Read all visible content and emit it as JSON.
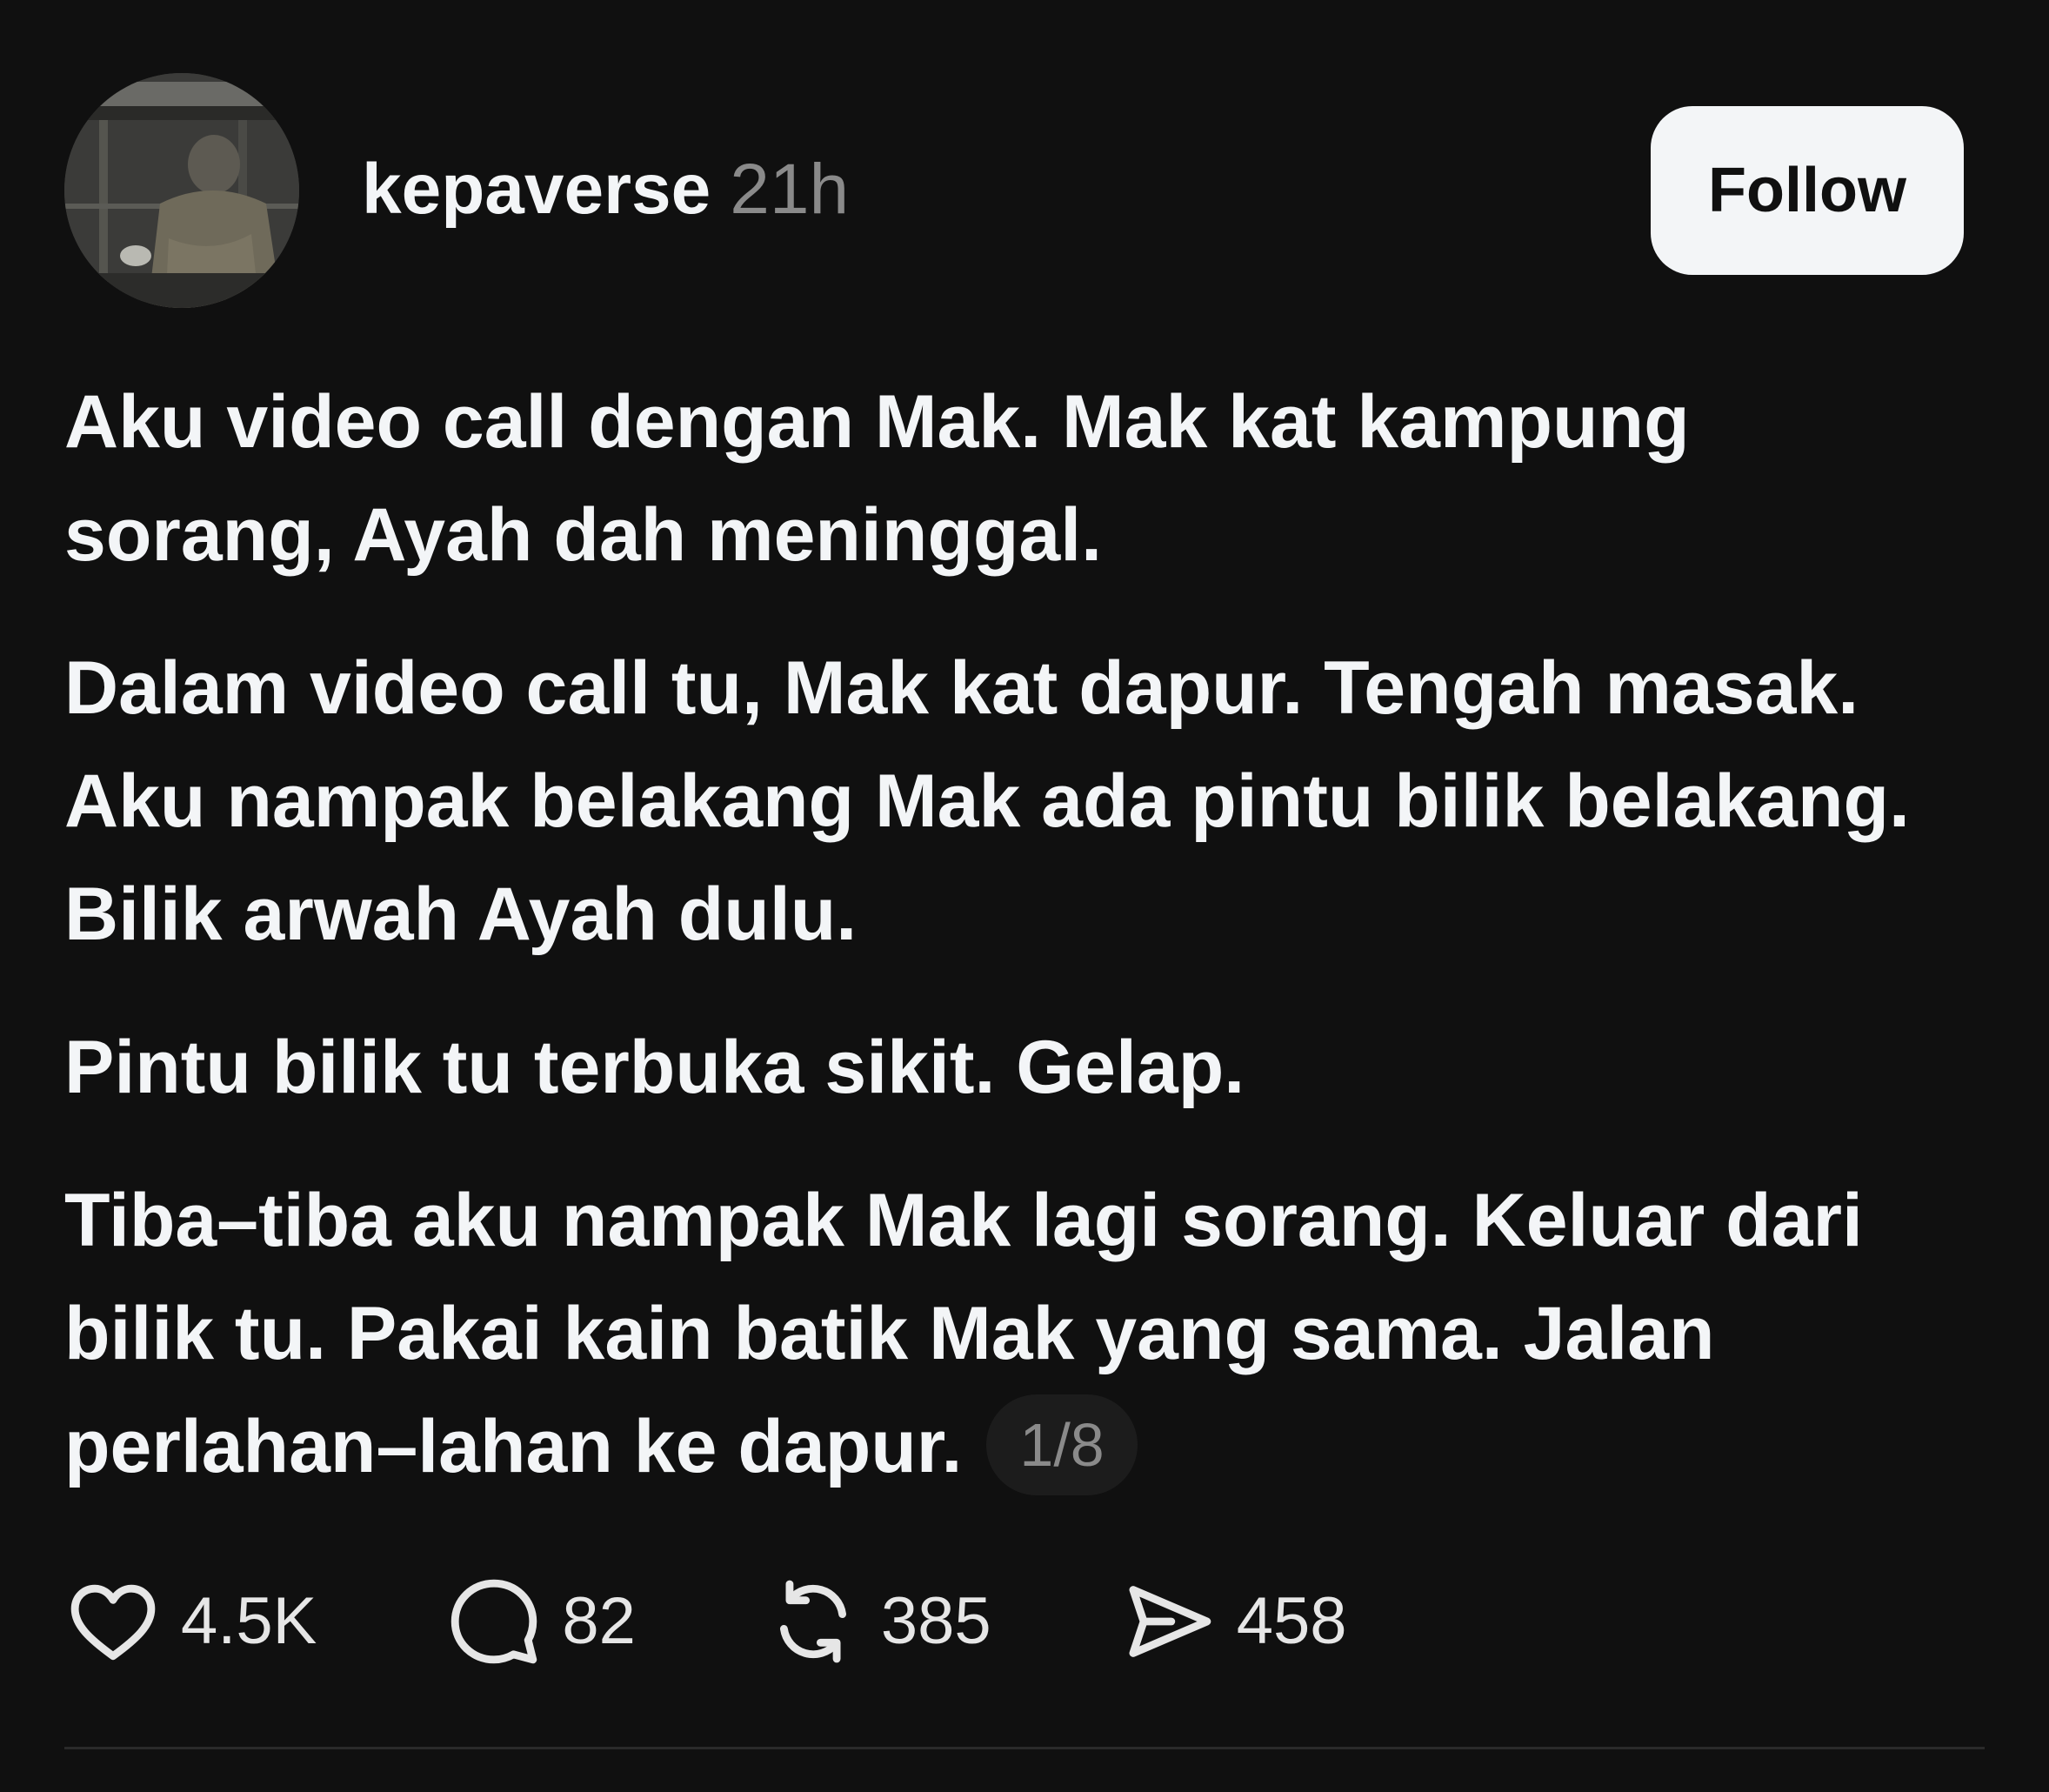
{
  "post": {
    "username": "kepaverse",
    "timestamp": "21h",
    "follow_label": "Follow",
    "paragraphs": [
      "Aku video call dengan Mak. Mak kat kampung sorang, Ayah dah meninggal.",
      "Dalam video call tu, Mak kat dapur. Tengah masak. Aku nampak belakang Mak ada pintu bilik belakang. Bilik arwah Ayah dulu.",
      "Pintu bilik tu terbuka sikit. Gelap.",
      "Tiba–tiba aku nampak Mak lagi sorang. Keluar dari bilik tu. Pakai kain batik Mak yang sama. Jalan perlahan–lahan ke dapur."
    ],
    "page_indicator": "1/8"
  },
  "actions": {
    "likes": "4.5K",
    "replies": "82",
    "reposts": "385",
    "shares": "458"
  },
  "icons": {
    "like": "heart-icon",
    "reply": "comment-bubble-icon",
    "repost": "repost-icon",
    "share": "send-icon"
  },
  "colors": {
    "background": "#101010",
    "text_primary": "#f3f5f7",
    "text_secondary": "#8a8a8a",
    "follow_button_bg": "#f3f5f7"
  }
}
